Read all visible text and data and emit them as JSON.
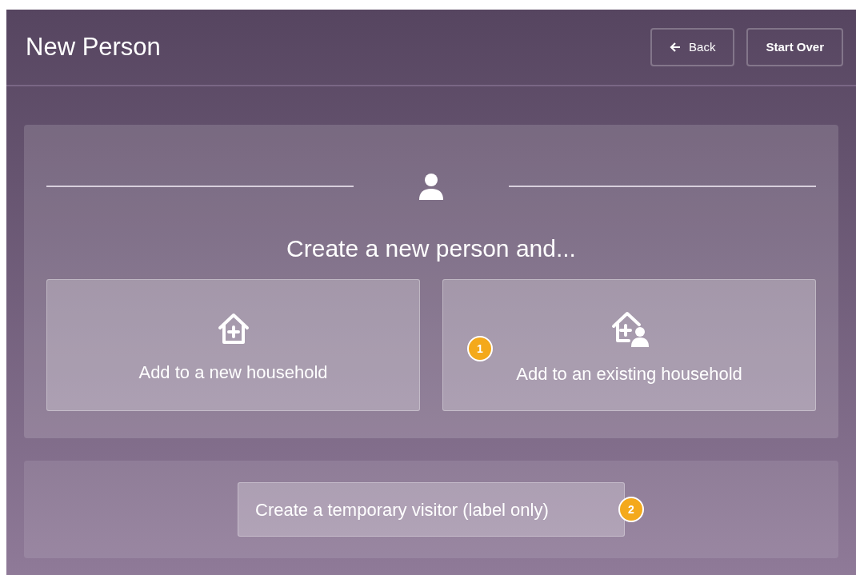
{
  "header": {
    "title": "New Person",
    "buttons": [
      {
        "kind": "back",
        "label": "Back"
      },
      {
        "kind": "plain",
        "label": "Start Over"
      }
    ]
  },
  "main": {
    "heading": "Create a new person and...",
    "options": [
      {
        "kind": "new",
        "label": "Add to a new household"
      },
      {
        "kind": "existing",
        "label": "Add to an existing household",
        "badge": "1"
      }
    ]
  },
  "footer": {
    "label": "Create a temporary visitor (label only)",
    "badge": "2"
  }
}
